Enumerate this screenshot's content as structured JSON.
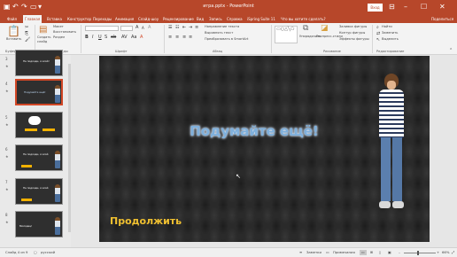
{
  "window": {
    "title": "игра.pptx - PowerPoint",
    "signin": "Вход",
    "qat": {
      "save": "save-icon",
      "undo": "undo-icon",
      "redo": "redo-icon",
      "start": "slideshow-icon"
    },
    "controls": {
      "minimize": "–",
      "maximize": "☐",
      "close": "✕"
    }
  },
  "tabs": [
    "Файл",
    "Главная",
    "Вставка",
    "Конструктор",
    "Переходы",
    "Анимация",
    "Слайд-шоу",
    "Рецензирование",
    "Вид",
    "Запись",
    "Справка",
    "iSpring Suite 11",
    "Что вы хотите сделать?"
  ],
  "active_tab": "Главная",
  "share": "Поделиться",
  "ribbon": {
    "clipboard": {
      "paste": "Вставить",
      "group": "Буфер обмена"
    },
    "slides": {
      "new_slide": "Создать слайд",
      "layout": "Макет",
      "reset": "Восстановить",
      "section": "Раздел",
      "group": "Слайды"
    },
    "font": {
      "group": "Шрифт"
    },
    "paragraph": {
      "text_direction": "Направление текста",
      "align_text": "Выровнять текст",
      "smartart": "Преобразовать в SmartArt",
      "group": "Абзац"
    },
    "drawing": {
      "arrange": "Упорядочить",
      "quick_styles": "Экспресс-стили",
      "fill": "Заливка фигуры",
      "outline": "Контур фигуры",
      "effects": "Эффекты фигуры",
      "group": "Рисование"
    },
    "editing": {
      "find": "Найти",
      "replace": "Заменить",
      "select": "Выделить",
      "group": "Редактирование"
    }
  },
  "thumbnails": [
    {
      "num": "3",
      "title": "Не подходи, я злой!"
    },
    {
      "num": "4",
      "title": "Подумайте ещё!"
    },
    {
      "num": "5",
      "title": ""
    },
    {
      "num": "6",
      "title": "Не подходи, я злой"
    },
    {
      "num": "7",
      "title": "Не подходи, я злой"
    },
    {
      "num": "8",
      "title": "Молодец!"
    }
  ],
  "slide": {
    "title": "Подумайте ещё!",
    "button_text": "Продолжить"
  },
  "status": {
    "slide_info": "Слайд 4 из 9",
    "language": "русский",
    "notes": "Заметки",
    "comments": "Примечания",
    "zoom": "66%"
  }
}
